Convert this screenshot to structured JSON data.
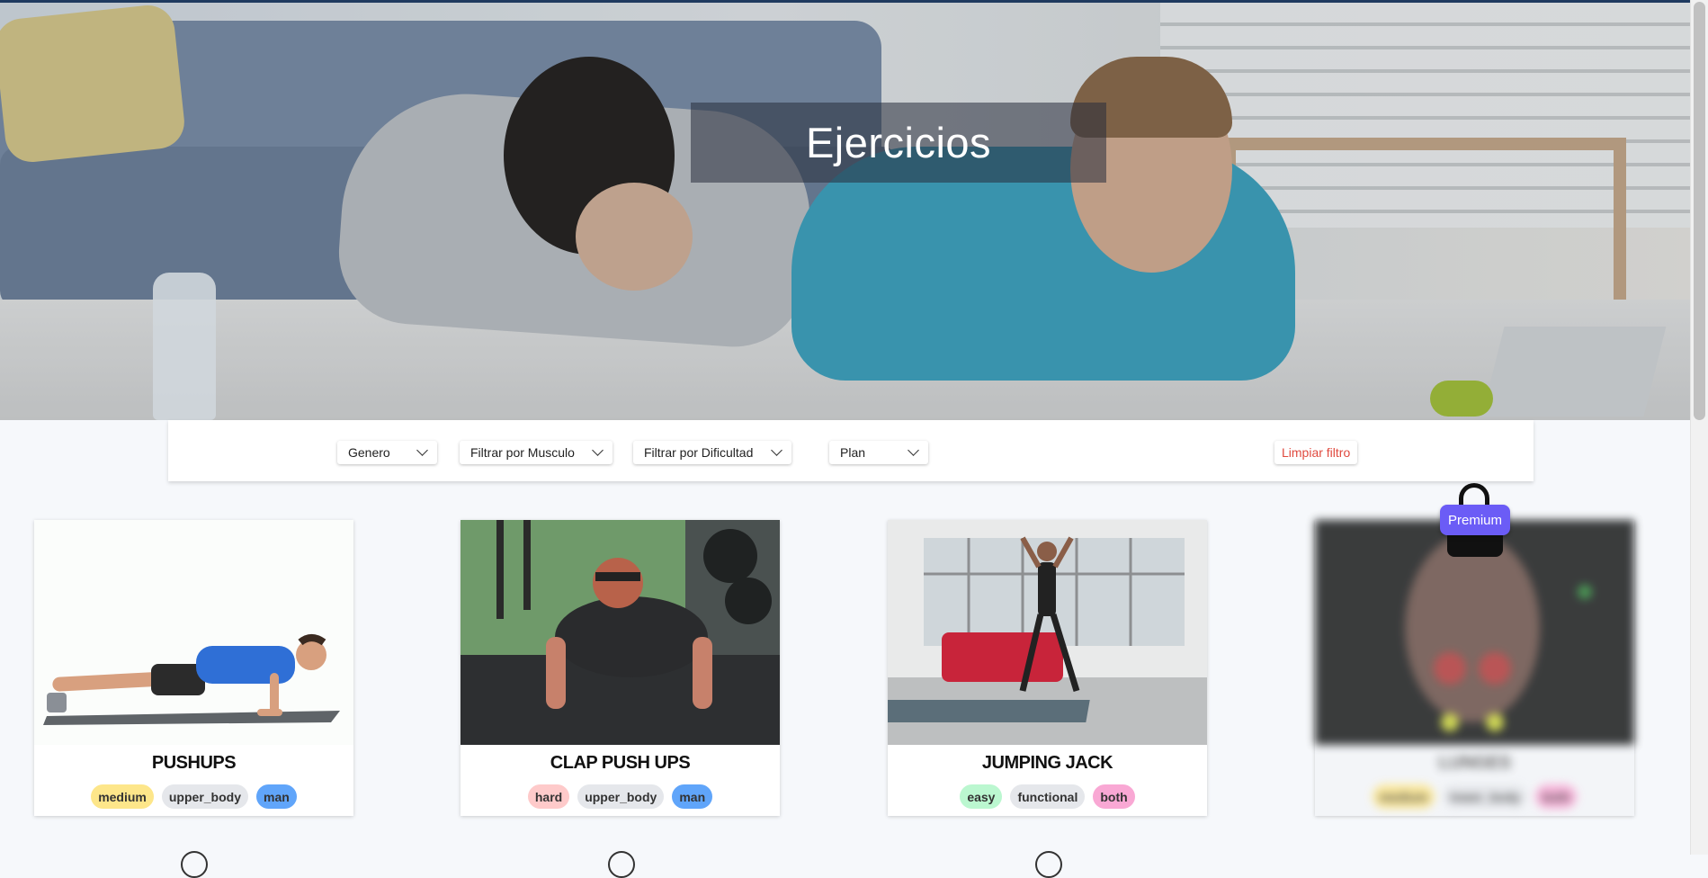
{
  "hero": {
    "title": "Ejercicios"
  },
  "filters": {
    "gender_label": "Genero",
    "muscle_label": "Filtrar por Musculo",
    "difficulty_label": "Filtrar por Dificultad",
    "plan_label": "Plan",
    "clear_label": "Limpiar filtro"
  },
  "exercises": [
    {
      "name": "PUSHUPS",
      "tags": [
        "medium",
        "upper_body",
        "man"
      ]
    },
    {
      "name": "CLAP PUSH UPS",
      "tags": [
        "hard",
        "upper_body",
        "man"
      ]
    },
    {
      "name": "JUMPING JACK",
      "tags": [
        "easy",
        "functional",
        "both"
      ]
    },
    {
      "name": "LUNGES",
      "tags": [
        "medium",
        "lower_body",
        "both"
      ],
      "premium_badge": "Premium"
    }
  ],
  "colors": {
    "medium": "#fde68a",
    "hard": "#fecaca",
    "easy": "#bbf7d0",
    "neutral": "#e5e7eb",
    "man": "#60a5fa",
    "both": "#f9a8d4",
    "premium": "#6b5cf6",
    "clear": "#e04a3f"
  }
}
